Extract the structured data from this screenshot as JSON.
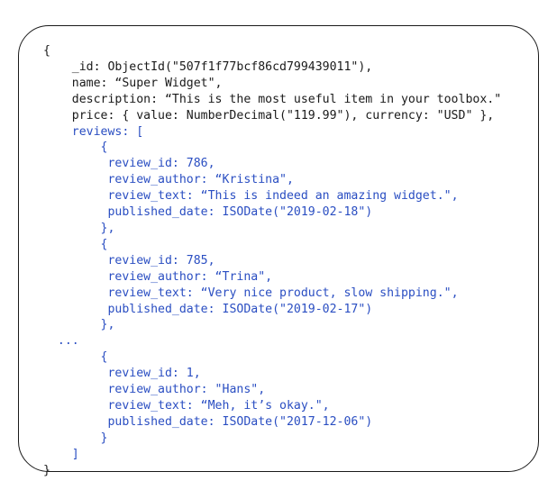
{
  "document": {
    "accent_color": "#2a4ec2",
    "text_color": "#1a1a1a",
    "lines": [
      {
        "indent": 0,
        "text": "{",
        "color": "black"
      },
      {
        "indent": 4,
        "text": "_id: ObjectId(\"507f1f77bcf86cd799439011\"),",
        "color": "black"
      },
      {
        "indent": 4,
        "text": "name: “Super Widget\",",
        "color": "black"
      },
      {
        "indent": 4,
        "text": "description: “This is the most useful item in your toolbox.\"",
        "color": "black"
      },
      {
        "indent": 4,
        "text": "price: { value: NumberDecimal(\"119.99\"), currency: \"USD\" },",
        "color": "black"
      },
      {
        "indent": 4,
        "text": "reviews: [",
        "color": "blue"
      },
      {
        "indent": 8,
        "text": "{",
        "color": "blue"
      },
      {
        "indent": 9,
        "text": "review_id: 786,",
        "color": "blue"
      },
      {
        "indent": 9,
        "text": "review_author: “Kristina\",",
        "color": "blue"
      },
      {
        "indent": 9,
        "text": "review_text: “This is indeed an amazing widget.\",",
        "color": "blue"
      },
      {
        "indent": 9,
        "text": "published_date: ISODate(\"2019-02-18\")",
        "color": "blue"
      },
      {
        "indent": 8,
        "text": "},",
        "color": "blue"
      },
      {
        "indent": 8,
        "text": "{",
        "color": "blue"
      },
      {
        "indent": 9,
        "text": "review_id: 785,",
        "color": "blue"
      },
      {
        "indent": 9,
        "text": "review_author: “Trina\",",
        "color": "blue"
      },
      {
        "indent": 9,
        "text": "review_text: “Very nice product, slow shipping.\",",
        "color": "blue"
      },
      {
        "indent": 9,
        "text": "published_date: ISODate(\"2019-02-17\")",
        "color": "blue"
      },
      {
        "indent": 8,
        "text": "},",
        "color": "blue"
      },
      {
        "indent": 2,
        "text": "...",
        "color": "blue"
      },
      {
        "indent": 8,
        "text": "{",
        "color": "blue"
      },
      {
        "indent": 9,
        "text": "review_id: 1,",
        "color": "blue"
      },
      {
        "indent": 9,
        "text": "review_author: \"Hans\",",
        "color": "blue"
      },
      {
        "indent": 9,
        "text": "review_text: “Meh, it’s okay.\",",
        "color": "blue"
      },
      {
        "indent": 9,
        "text": "published_date: ISODate(\"2017-12-06\")",
        "color": "blue"
      },
      {
        "indent": 8,
        "text": "}",
        "color": "blue"
      },
      {
        "indent": 4,
        "text": "]",
        "color": "blue"
      },
      {
        "indent": 0,
        "text": "}",
        "color": "black"
      }
    ]
  }
}
